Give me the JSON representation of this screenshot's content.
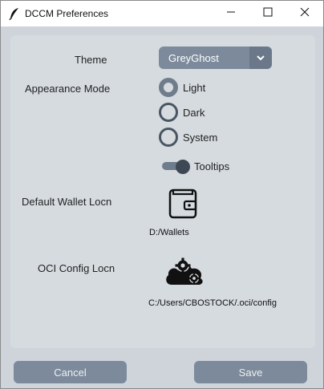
{
  "window": {
    "title": "DCCM Preferences",
    "icon": "feather-icon"
  },
  "window_controls": {
    "minimize_icon": "minimize-icon",
    "maximize_icon": "maximize-icon",
    "close_icon": "close-icon"
  },
  "form": {
    "theme_label": "Theme",
    "theme_value": "GreyGhost",
    "appearance_label": "Appearance Mode",
    "appearance_options": [
      "Light",
      "Dark",
      "System"
    ],
    "appearance_selected": "Light",
    "tooltips_label": "Tooltips",
    "tooltips_enabled": true,
    "wallet_label": "Default Wallet Locn",
    "wallet_icon": "wallet-icon",
    "wallet_path": "D:/Wallets",
    "oci_label": "OCI Config Locn",
    "oci_icon": "cloud-gears-icon",
    "oci_path": "C:/Users/CBOSTOCK/.oci/config"
  },
  "buttons": {
    "cancel": "Cancel",
    "save": "Save"
  },
  "colors": {
    "accent": "#7c8a9b",
    "panel": "#d6dbe0",
    "window_bg": "#ced4da"
  }
}
